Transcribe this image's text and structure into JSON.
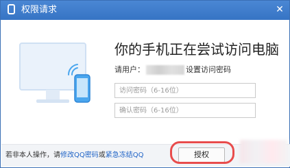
{
  "window": {
    "title": "权限请求",
    "close_glyph": "✕"
  },
  "main": {
    "heading": "你的手机正在尝试访问电脑",
    "user_prefix": "请用户：",
    "user_suffix": "设置访问密码",
    "password_placeholder": "访问密码（6-16位）",
    "confirm_placeholder": "确认密码（6-16位）"
  },
  "footer": {
    "text_prefix": "若非本人操作，请",
    "link_change_password": "修改QQ密码",
    "text_or": "或",
    "link_freeze": "紧急冻结QQ",
    "authorize_label": "授权"
  },
  "colors": {
    "titlebar": "#3a7bd0",
    "link": "#1f63c6",
    "annotation": "#e84c4c"
  },
  "icons": [
    "phone-window-icon",
    "close-icon",
    "monitor-icon",
    "phone-icon",
    "wifi-signal-icon"
  ]
}
